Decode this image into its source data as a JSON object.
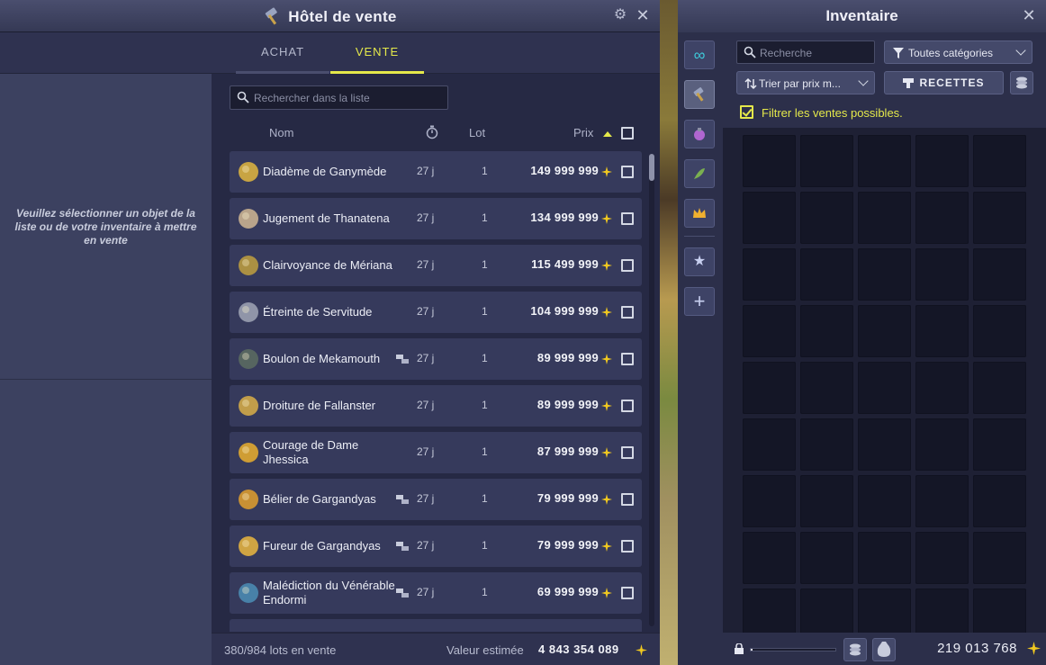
{
  "hdv": {
    "title": "Hôtel de vente",
    "tabs": {
      "achat": "ACHAT",
      "vente": "VENTE"
    },
    "left_message": "Veuillez sélectionner un objet de la liste ou de votre inventaire à mettre en vente",
    "search_placeholder": "Rechercher dans la liste",
    "columns": {
      "nom": "Nom",
      "lot": "Lot",
      "prix": "Prix"
    },
    "rows": [
      {
        "name": "Diadème de Ganymède",
        "duration": "27 j",
        "lot": "1",
        "price": "149 999 999",
        "tradeable": false,
        "icon": "diadem-icon"
      },
      {
        "name": "Jugement de Thanatena",
        "duration": "27 j",
        "lot": "1",
        "price": "134 999 999",
        "tradeable": false,
        "icon": "scythe-icon"
      },
      {
        "name": "Clairvoyance de Mériana",
        "duration": "27 j",
        "lot": "1",
        "price": "115 499 999",
        "tradeable": false,
        "icon": "lantern-icon"
      },
      {
        "name": "Étreinte de Servitude",
        "duration": "27 j",
        "lot": "1",
        "price": "104 999 999",
        "tradeable": false,
        "icon": "belt-icon"
      },
      {
        "name": "Boulon de Mekamouth",
        "duration": "27 j",
        "lot": "1",
        "price": "89 999 999",
        "tradeable": true,
        "icon": "boulder-icon"
      },
      {
        "name": "Droiture de Fallanster",
        "duration": "27 j",
        "lot": "1",
        "price": "89 999 999",
        "tradeable": false,
        "icon": "idol-icon"
      },
      {
        "name": "Courage de Dame Jhessica",
        "duration": "27 j",
        "lot": "1",
        "price": "87 999 999",
        "tradeable": false,
        "icon": "ring-icon"
      },
      {
        "name": "Bélier de Gargandyas",
        "duration": "27 j",
        "lot": "1",
        "price": "79 999 999",
        "tradeable": true,
        "icon": "amulet-icon"
      },
      {
        "name": "Fureur de Gargandyas",
        "duration": "27 j",
        "lot": "1",
        "price": "79 999 999",
        "tradeable": true,
        "icon": "hammer-icon"
      },
      {
        "name": "Malédiction du Vénérable Endormi",
        "duration": "27 j",
        "lot": "1",
        "price": "69 999 999",
        "tradeable": true,
        "icon": "tome-icon"
      }
    ],
    "footer": {
      "count": "380/984 lots en vente",
      "estimate_label": "Valeur estimée",
      "estimate_value": "4 843 354 089"
    }
  },
  "inventory": {
    "title": "Inventaire",
    "search_placeholder": "Recherche",
    "category_select": "Toutes catégories",
    "sort_select": "Trier par prix m...",
    "recipes_button": "RECETTES",
    "filter_label": "Filtrer les ventes possibles.",
    "filter_checked": true,
    "kamas": "219 013 768",
    "weight_fraction": 0.02,
    "categories": [
      "infinity-icon",
      "equipment-icon",
      "consumable-icon",
      "resource-icon",
      "crown-icon",
      "star-icon",
      "plus-icon"
    ]
  },
  "colors": {
    "accent": "#e4e84a",
    "panel": "#2a2d45",
    "row": "#363a5c"
  }
}
